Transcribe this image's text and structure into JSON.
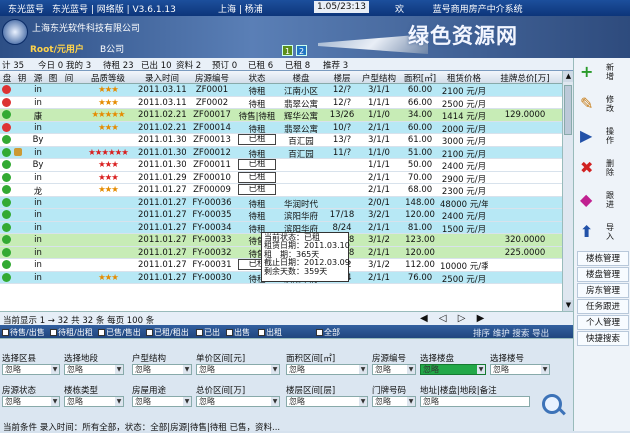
{
  "titlebar": {
    "app_a": "东光蓝号",
    "app_b": "东光蓝号 | 网络版 | V3.6.1.13",
    "location": "上海 | 杨浦",
    "clock": "1.05/23:13",
    "welcome": "欢",
    "system": "蓝号商用房产中介系统"
  },
  "banner": {
    "company": "上海东光软件科技有限公司",
    "user": "Root/元用户",
    "office": "B公司",
    "fkey1": "1",
    "fkey2": "2",
    "watermark": "绿色资源网"
  },
  "tabs": [
    "计 35",
    "今日 0",
    "我的 3",
    "待租 23",
    "已出 10",
    "资料 2",
    "预订 0",
    "已租 6",
    "已租 8",
    "推荐 3"
  ],
  "columns": [
    "盘",
    "钥",
    "源",
    "图",
    "间",
    "品质等级",
    "录入时间",
    "房源编号",
    "状态",
    "楼盘",
    "楼层",
    "户型结构",
    "面积[㎡]",
    "租赁价格",
    "挂牌总价[万]"
  ],
  "rows": [
    {
      "bg": "cyan",
      "ic": "#d33",
      "ic2": "",
      "src": "in",
      "stars": 3,
      "red": false,
      "date": "2011.03.11",
      "code": "ZF0001",
      "status": "待租",
      "boxed": false,
      "estate": "江南小区",
      "floor": "12/?",
      "layout": "3/1/1",
      "area": "60.00",
      "price": "2100",
      "unit": "元/月",
      "total": ""
    },
    {
      "bg": "white",
      "ic": "#d33",
      "ic2": "",
      "src": "in",
      "stars": 3,
      "red": false,
      "date": "2011.03.11",
      "code": "ZF0002",
      "status": "待租",
      "boxed": false,
      "estate": "翡翠公寓",
      "floor": "12/?",
      "layout": "1/1/1",
      "area": "66.00",
      "price": "2500",
      "unit": "元/月",
      "total": ""
    },
    {
      "bg": "green",
      "ic": "#3a3",
      "ic2": "",
      "src": "康",
      "stars": 5,
      "red": false,
      "date": "2011.02.21",
      "code": "ZF00017",
      "status": "待售|待租",
      "boxed": false,
      "estate": "辉华公寓",
      "floor": "13/26",
      "layout": "1/1/0",
      "area": "34.00",
      "price": "1414",
      "unit": "元/月",
      "total": "129.0000"
    },
    {
      "bg": "cyan",
      "ic": "#d33",
      "ic2": "",
      "src": "in",
      "stars": 3,
      "red": false,
      "date": "2011.02.21",
      "code": "ZF00014",
      "status": "待租",
      "boxed": false,
      "estate": "翡翠公寓",
      "floor": "10/?",
      "layout": "2/1/1",
      "area": "60.00",
      "price": "2000",
      "unit": "元/月",
      "total": ""
    },
    {
      "bg": "white",
      "ic": "#3a3",
      "ic2": "",
      "src": "By",
      "stars": 0,
      "red": false,
      "date": "2011.01.30",
      "code": "ZF00013",
      "status": "已租",
      "boxed": true,
      "estate": "百汇园",
      "floor": "13/?",
      "layout": "3/1/1",
      "area": "61.00",
      "price": "3000",
      "unit": "元/月",
      "total": ""
    },
    {
      "bg": "cyan",
      "ic": "#3a3",
      "ic2": "#c93",
      "src": "in",
      "stars": 6,
      "red": true,
      "date": "2011.01.30",
      "code": "ZF00012",
      "status": "待租",
      "boxed": false,
      "estate": "百汇园",
      "floor": "11/?",
      "layout": "1/1/0",
      "area": "51.00",
      "price": "2100",
      "unit": "元/月",
      "total": ""
    },
    {
      "bg": "white",
      "ic": "#3a3",
      "ic2": "",
      "src": "By",
      "stars": 3,
      "red": true,
      "date": "2011.01.30",
      "code": "ZF00011",
      "status": "已租",
      "boxed": true,
      "estate": "",
      "floor": "",
      "layout": "1/1/1",
      "area": "50.00",
      "price": "2400",
      "unit": "元/月",
      "total": ""
    },
    {
      "bg": "white",
      "ic": "#3a3",
      "ic2": "",
      "src": "in",
      "stars": 3,
      "red": true,
      "date": "2011.01.29",
      "code": "ZF00010",
      "status": "已租",
      "boxed": true,
      "estate": "",
      "floor": "",
      "layout": "2/1/1",
      "area": "70.00",
      "price": "2900",
      "unit": "元/月",
      "total": ""
    },
    {
      "bg": "white",
      "ic": "#3a3",
      "ic2": "",
      "src": "龙",
      "stars": 3,
      "red": false,
      "date": "2011.01.27",
      "code": "ZF00009",
      "status": "已租",
      "boxed": true,
      "estate": "",
      "floor": "",
      "layout": "2/1/1",
      "area": "68.00",
      "price": "2300",
      "unit": "元/月",
      "total": ""
    },
    {
      "bg": "cyan",
      "ic": "#3a3",
      "ic2": "",
      "src": "in",
      "stars": 0,
      "red": false,
      "date": "2011.01.27",
      "code": "FY-00036",
      "status": "待租",
      "boxed": false,
      "estate": "华润时代",
      "floor": "",
      "layout": "2/0/1",
      "area": "148.00",
      "price": "48000",
      "unit": "元/年",
      "total": ""
    },
    {
      "bg": "cyan",
      "ic": "#3a3",
      "ic2": "",
      "src": "in",
      "stars": 0,
      "red": false,
      "date": "2011.01.27",
      "code": "FY-00035",
      "status": "待租",
      "boxed": false,
      "estate": "滨阳华府",
      "floor": "17/18",
      "layout": "3/2/1",
      "area": "120.00",
      "price": "2400",
      "unit": "元/月",
      "total": ""
    },
    {
      "bg": "cyan",
      "ic": "#3a3",
      "ic2": "",
      "src": "in",
      "stars": 0,
      "red": false,
      "date": "2011.01.27",
      "code": "FY-00034",
      "status": "待租",
      "boxed": false,
      "estate": "滨阳华府",
      "floor": "8/24",
      "layout": "2/1/1",
      "area": "81.00",
      "price": "1500",
      "unit": "元/月",
      "total": ""
    },
    {
      "bg": "green",
      "ic": "#3a3",
      "ic2": "",
      "src": "in",
      "stars": 0,
      "red": false,
      "date": "2011.01.27",
      "code": "FY-00033",
      "status": "待售",
      "boxed": false,
      "estate": "玉兰花苑",
      "floor": "23/28",
      "layout": "3/1/2",
      "area": "123.00",
      "price": "",
      "unit": "",
      "total": "320.0000"
    },
    {
      "bg": "green",
      "ic": "#3a3",
      "ic2": "",
      "src": "in",
      "stars": 0,
      "red": false,
      "date": "2011.01.27",
      "code": "FY-00032",
      "status": "待售",
      "boxed": false,
      "estate": "滨阳华府",
      "floor": "22/28",
      "layout": "2/1/1",
      "area": "120.00",
      "price": "",
      "unit": "",
      "total": "225.0000"
    },
    {
      "bg": "white",
      "ic": "#3a3",
      "ic2": "",
      "src": "in",
      "stars": 0,
      "red": false,
      "date": "2011.01.27",
      "code": "FY-00031",
      "status": "已租",
      "boxed": true,
      "estate": "翡翠公寓",
      "floor": "3/12",
      "layout": "3/1/2",
      "area": "112.00",
      "price": "10000",
      "unit": "元/季",
      "total": ""
    },
    {
      "bg": "cyan",
      "ic": "#3a3",
      "ic2": "",
      "src": "in",
      "stars": 3,
      "red": false,
      "date": "2011.01.27",
      "code": "FY-00030",
      "status": "待租",
      "boxed": false,
      "estate": "滨阳华府",
      "floor": "5/24",
      "layout": "2/1/1",
      "area": "76.00",
      "price": "2500",
      "unit": "元/月",
      "total": ""
    }
  ],
  "tooltip": [
    "当前状态：已租",
    "租赁日期：2011.03.10",
    "租　期：365天",
    "截止日期：2012.03.09",
    "剩余天数：359天"
  ],
  "pager": {
    "text": "当前显示 1 → 32 共 32 条 每页 100 条",
    "nav": "◀ ◁ ▷ ▶"
  },
  "filterbar": {
    "items": [
      "待售/出售",
      "待租/出租",
      "已售/售出",
      "已租/租出",
      "已出",
      "出售",
      "出租",
      "全部"
    ],
    "actions": "排序 维护 搜索 导出"
  },
  "search": {
    "labels1": [
      "选择区县",
      "选择地段",
      "户型结构",
      "单价区间[元]",
      "面积区间[㎡]",
      "房源编号",
      "选择楼盘",
      "选择楼号"
    ],
    "labels2": [
      "房源状态",
      "楼栋类型",
      "房屋用途",
      "总价区间[万]",
      "楼层区间[层]",
      "门牌号码",
      "地址|楼盘|地段|备注"
    ],
    "placeholder": "忽略",
    "status": "当前条件 录入时间：所有全部，状态：全部|房源|待售|待租 已售，资料..."
  },
  "sidebar": {
    "buttons": [
      {
        "icon": "+",
        "label": "新增",
        "color": "#2a9a2a"
      },
      {
        "icon": "✎",
        "label": "修改",
        "color": "#c77a12"
      },
      {
        "icon": "▶",
        "label": "操作",
        "color": "#2251a8"
      },
      {
        "icon": "✖",
        "label": "删除",
        "color": "#d12222"
      },
      {
        "icon": "◆",
        "label": "跟进",
        "color": "#c02090"
      },
      {
        "icon": "⬆",
        "label": "导入",
        "color": "#2251a8"
      }
    ],
    "links": [
      "楼栋管理",
      "楼盘管理",
      "房东管理",
      "任务跟进",
      "个人管理",
      "快捷搜索"
    ]
  }
}
